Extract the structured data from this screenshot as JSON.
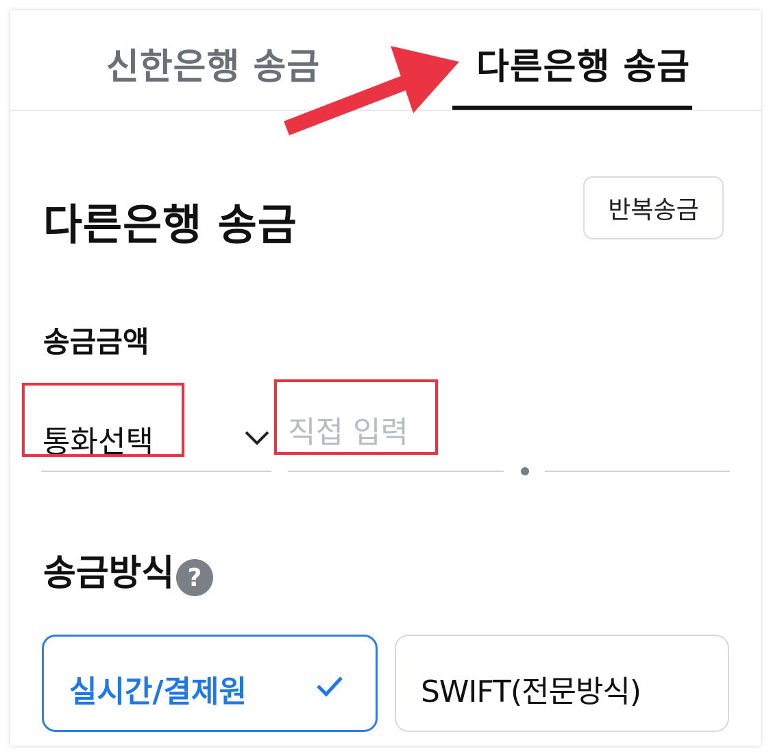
{
  "tabs": [
    {
      "label": "신한은행 송금",
      "active": false
    },
    {
      "label": "다른은행 송금",
      "active": true
    }
  ],
  "header": {
    "title": "다른은행 송금",
    "repeat_button": "반복송금"
  },
  "amount": {
    "label": "송금금액",
    "currency_select": "통화선택",
    "input_placeholder": "직접 입력",
    "input_value": ""
  },
  "method": {
    "label": "송금방식",
    "help_symbol": "?",
    "options": [
      {
        "label": "실시간/결제원",
        "selected": true
      },
      {
        "label": "SWIFT(전문방식)",
        "selected": false
      }
    ]
  },
  "colors": {
    "accent": "#1f78e4",
    "annotation": "#ea3443",
    "active_tab": "#111111",
    "inactive_tab": "#6b7078"
  },
  "icons": [
    "chevron-down-icon",
    "help-icon",
    "check-icon",
    "arrow-annotation-icon"
  ]
}
